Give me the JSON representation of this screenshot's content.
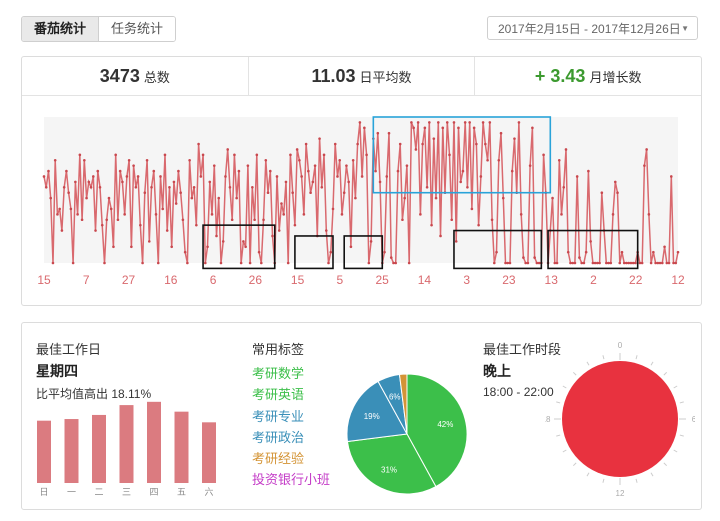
{
  "tabs": [
    {
      "label": "番茄统计",
      "active": true
    },
    {
      "label": "任务统计",
      "active": false
    }
  ],
  "date_range": "2017年2月15日 - 2017年12月26日",
  "stats": {
    "total": {
      "value": "3473",
      "label": "总数"
    },
    "daily_avg": {
      "value": "11.03",
      "label": "日平均数"
    },
    "monthly_growth": {
      "value": "+ 3.43",
      "label": "月增长数"
    }
  },
  "colors": {
    "line": "#d9696e",
    "highlight_box": "#29a3d9",
    "annotation_box": "#111111",
    "bar": "#db7b80",
    "green": "#3c9a2f"
  },
  "best_day": {
    "title": "最佳工作日",
    "day": "星期四",
    "compare": "比平均值高出 18.11%"
  },
  "common_tags": {
    "title": "常用标签",
    "tags": [
      {
        "label": "考研数学",
        "color": "#3cbf4a"
      },
      {
        "label": "考研英语",
        "color": "#3cbf4a"
      },
      {
        "label": "考研专业",
        "color": "#3a8fb8"
      },
      {
        "label": "考研政治",
        "color": "#3a8fb8"
      },
      {
        "label": "考研经验",
        "color": "#d49436"
      },
      {
        "label": "投资银行小班",
        "color": "#c43cc7"
      }
    ]
  },
  "best_period": {
    "title": "最佳工作时段",
    "period": "晚上",
    "time": "18:00 - 22:00",
    "clock_labels": [
      "0",
      "6",
      "12",
      "18"
    ],
    "fill": "#e8323f"
  },
  "chart_data": [
    {
      "type": "line",
      "title": "",
      "x_tick_labels": [
        "15",
        "7",
        "27",
        "16",
        "6",
        "26",
        "15",
        "5",
        "25",
        "14",
        "3",
        "23",
        "13",
        "2",
        "22",
        "12"
      ],
      "series": [
        {
          "values": [
            16,
            14,
            17,
            12,
            0,
            19,
            9,
            10,
            6,
            14,
            17,
            13,
            10,
            0,
            15,
            9,
            20,
            8,
            19,
            12,
            15,
            14,
            16,
            6,
            17,
            14,
            7,
            0,
            8,
            12,
            10,
            3,
            20,
            8,
            17,
            15,
            9,
            16,
            19,
            3,
            18,
            14,
            16,
            7,
            0,
            13,
            19,
            4,
            14,
            17,
            9,
            0,
            16,
            10,
            20,
            6,
            14,
            3,
            15,
            11,
            17,
            13,
            8,
            2,
            0,
            19,
            12,
            14,
            7,
            22,
            16,
            20,
            0,
            3,
            15,
            9,
            18,
            5,
            12,
            0,
            4,
            16,
            21,
            14,
            8,
            20,
            12,
            17,
            0,
            4,
            3,
            18,
            0,
            14,
            8,
            20,
            2,
            0,
            8,
            19,
            13,
            17,
            5,
            0,
            16,
            6,
            11,
            9,
            15,
            0,
            20,
            13,
            7,
            21,
            19,
            16,
            9,
            22,
            17,
            13,
            15,
            18,
            5,
            23,
            14,
            20,
            6,
            0,
            2,
            10,
            22,
            16,
            19,
            9,
            13,
            18,
            15,
            3,
            19,
            12,
            22,
            26,
            16,
            25,
            20,
            0,
            4,
            23,
            17,
            24,
            15,
            0,
            2,
            16,
            24,
            1,
            0,
            0,
            17,
            22,
            8,
            12,
            18,
            0,
            26,
            25,
            21,
            26,
            9,
            22,
            25,
            14,
            26,
            7,
            23,
            12,
            26,
            5,
            25,
            13,
            26,
            20,
            8,
            26,
            4,
            25,
            15,
            17,
            26,
            14,
            26,
            10,
            25,
            22,
            7,
            16,
            26,
            22,
            19,
            26,
            8,
            0,
            2,
            19,
            24,
            12,
            0,
            0,
            0,
            17,
            23,
            13,
            26,
            9,
            1,
            0,
            0,
            18,
            25,
            1,
            0,
            0,
            0,
            20,
            13,
            0,
            6,
            12,
            0,
            0,
            19,
            9,
            14,
            21,
            2,
            0,
            0,
            0,
            16,
            1,
            0,
            0,
            2,
            17,
            4,
            0,
            0,
            0,
            0,
            13,
            6,
            0,
            0,
            0,
            9,
            15,
            13,
            0,
            2,
            0,
            0,
            0,
            0,
            0,
            0,
            2,
            0,
            0,
            18,
            21,
            9,
            0,
            2,
            0,
            0,
            0,
            0,
            3,
            0,
            0,
            16,
            0,
            0,
            2
          ]
        }
      ],
      "ylim": [
        0,
        27
      ]
    },
    {
      "type": "bar",
      "categories": [
        "日",
        "一",
        "二",
        "三",
        "四",
        "五",
        "六"
      ],
      "values": [
        76,
        78,
        83,
        95,
        99,
        87,
        74
      ],
      "ylim": [
        0,
        100
      ]
    },
    {
      "type": "pie",
      "slices": [
        {
          "label": "42%",
          "value": 42,
          "color": "#3cbf4a"
        },
        {
          "label": "31%",
          "value": 31,
          "color": "#3cbf4a"
        },
        {
          "label": "19%",
          "value": 19,
          "color": "#3a8fb8"
        },
        {
          "label": "6%",
          "value": 6,
          "color": "#3a8fb8"
        },
        {
          "label": "",
          "value": 2,
          "color": "#d49436"
        }
      ]
    }
  ]
}
